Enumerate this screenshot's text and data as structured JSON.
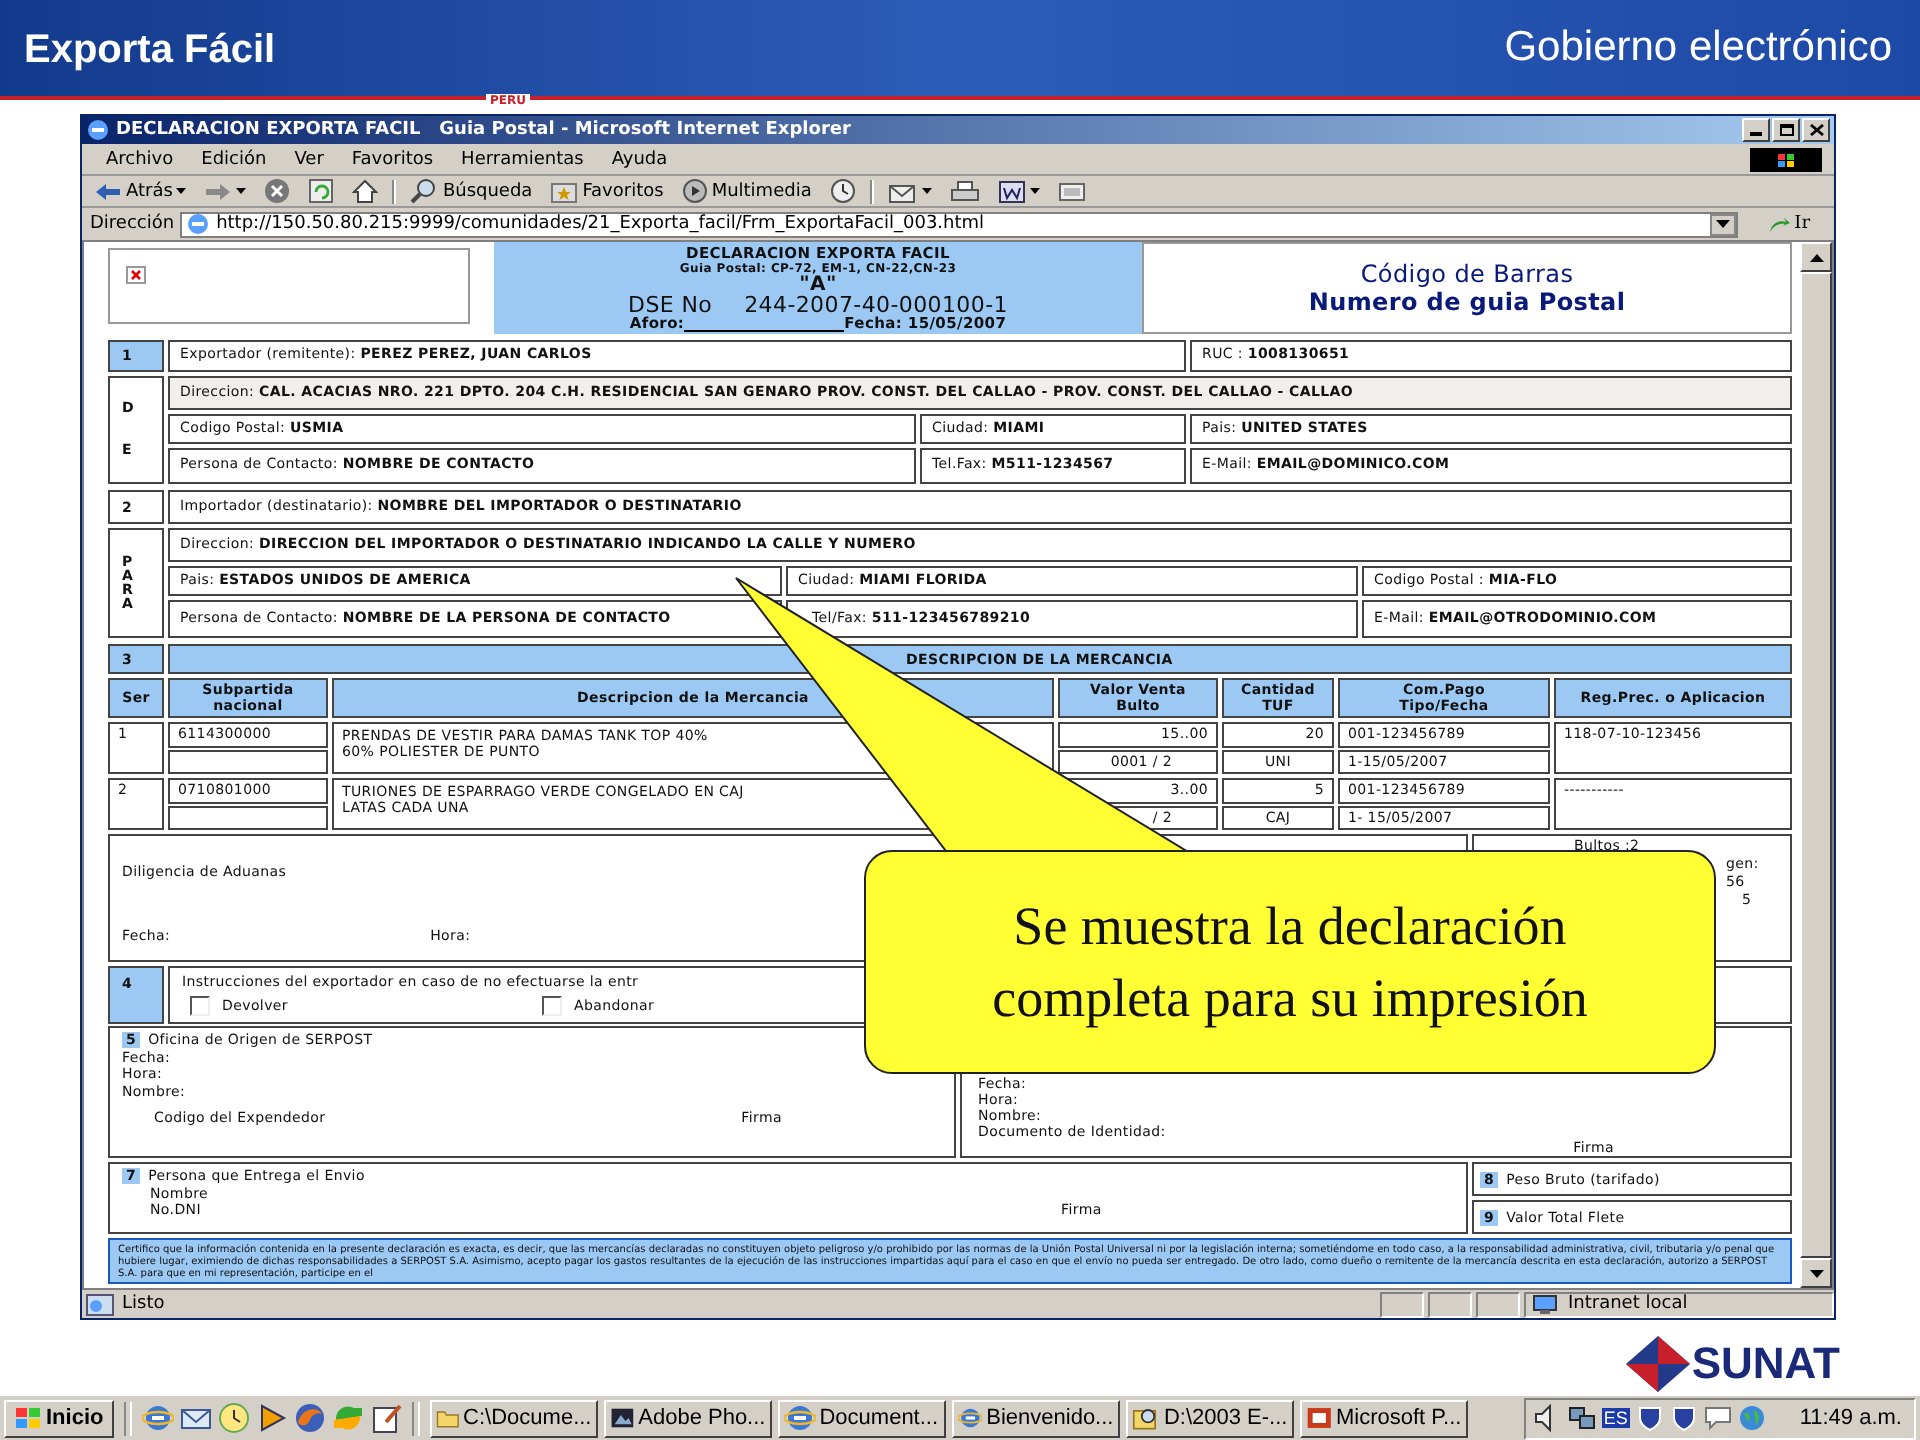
{
  "slide": {
    "title": "Exporta Fácil",
    "subtitle": "Gobierno electrónico",
    "tag": "PERU"
  },
  "window": {
    "title": "DECLARACION EXPORTA FACIL   Guia Postal - Microsoft Internet Explorer"
  },
  "menu": [
    "Archivo",
    "Edición",
    "Ver",
    "Favoritos",
    "Herramientas",
    "Ayuda"
  ],
  "toolbar": [
    {
      "kind": "back",
      "label": "Atrás",
      "dropdown": true
    },
    {
      "kind": "forward",
      "dropdown": true
    },
    {
      "kind": "stop",
      "dropdown": false
    },
    {
      "kind": "refresh",
      "dropdown": false
    },
    {
      "kind": "home",
      "dropdown": false
    },
    {
      "kind": "search",
      "label": "Búsqueda",
      "dropdown": false
    },
    {
      "kind": "favorites",
      "label": "Favoritos",
      "dropdown": false
    },
    {
      "kind": "media",
      "label": "Multimedia",
      "dropdown": false
    },
    {
      "kind": "history",
      "dropdown": false
    },
    {
      "kind": "mail",
      "dropdown": true
    },
    {
      "kind": "print",
      "dropdown": false
    },
    {
      "kind": "word",
      "dropdown": true
    },
    {
      "kind": "discuss",
      "dropdown": false
    }
  ],
  "address": {
    "label": "Dirección",
    "value": "http://150.50.80.215:9999/comunidades/21_Exporta_facil/Frm_ExportaFacil_003.html",
    "go": "Ir"
  },
  "form": {
    "header": {
      "title": "DECLARACION EXPORTA FACIL",
      "guia": "Guia Postal: CP-72, EM-1, CN-22,CN-23",
      "letter": "\"A\"",
      "dse_label": "DSE No",
      "dse": "244-2007-40-000100-1",
      "aforo": "Aforo:",
      "fecha": "Fecha: 15/05/2007",
      "barcode_title": "Código de Barras",
      "barcode_subtitle": "Numero de guia Postal"
    },
    "sections": [
      {
        "number": "1",
        "side": [
          "D",
          "E"
        ],
        "rows": [
          {
            "fields": [
              "Exportador (remitente): **PEREZ PEREZ, JUAN CARLOS**",
              "RUC : **1008130651**"
            ]
          },
          {
            "fields": [
              "Direccion: **CAL. ACACIAS NRO. 221 DPTO. 204 C.H. RESIDENCIAL SAN GENARO  PROV. CONST. DEL CALLAO - PROV. CONST. DEL CALLAO - CALLAO**"
            ]
          },
          {
            "fields": [
              "Codigo Postal: **USMIA**",
              "Ciudad: **MIAMI**",
              "Pais: **UNITED STATES**"
            ]
          },
          {
            "fields": [
              "Persona de Contacto: **NOMBRE DE CONTACTO**",
              "Tel.Fax: **M511-1234567**",
              "E-Mail: **EMAIL@DOMINICO.COM**"
            ]
          }
        ]
      },
      {
        "number": "2",
        "side": [
          "P",
          "A",
          "R",
          "A"
        ],
        "rows": [
          {
            "fields": [
              "Importador (destinatario): **NOMBRE DEL IMPORTADOR O DESTINATARIO**"
            ]
          },
          {
            "fields": [
              "Direccion: **DIRECCION DEL IMPORTADOR O DESTINATARIO INDICANDO LA CALLE Y NUMERO**"
            ]
          },
          {
            "fields": [
              "Pais: **ESTADOS UNIDOS DE AMERICA**",
              "Ciudad: **MIAMI FLORIDA**",
              "Codigo Postal : **MIA-FLO**"
            ]
          },
          {
            "fields": [
              "Persona de Contacto: **NOMBRE DE LA PERSONA DE CONTACTO**",
              "Tel/Fax: **511-123456789210**",
              "E-Mail: **EMAIL@OTRODOMINIO.COM**"
            ]
          }
        ]
      }
    ],
    "goods": {
      "number": "3",
      "title": "DESCRIPCION DE LA MERCANCIA",
      "columns": [
        "Ser",
        "Subpartida nacional",
        "Descripcion de la Mercancia",
        "Valor Venta Bulto",
        "Cantidad TUF",
        "Com.Pago Tipo/Fecha",
        "Reg.Prec. o Aplicacion"
      ],
      "rows": [
        {
          "ser": "1",
          "subpartida": "6114300000",
          "description": [
            "PRENDAS DE VESTIR PARA DAMAS TANK TOP 40%",
            "60% POLIESTER DE PUNTO"
          ],
          "value": "15..00",
          "packages": "0001 / 2",
          "quantity": "20",
          "unit": "UNI",
          "payment": "001-123456789",
          "payment_date": "1-15/05/2007",
          "regime": "118-07-10-123456"
        },
        {
          "ser": "2",
          "subpartida": "0710801000",
          "description": [
            "TURIONES DE ESPARRAGO VERDE CONGELADO EN CAJ",
            "LATAS CADA UNA"
          ],
          "value": "3..00",
          "packages": "/ 2",
          "quantity": "5",
          "unit": "CAJ",
          "payment": "001-123456789",
          "payment_date": "1- 15/05/2007",
          "regime": "-----------"
        }
      ]
    },
    "customs": {
      "title": "Diligencia de Aduanas",
      "date": "Fecha:",
      "time": "Hora:",
      "summary": [
        "Bultos :2",
        "gen:",
        "56",
        "5"
      ]
    },
    "instructions": {
      "number": "4",
      "text": "Instrucciones del exportador en caso de no efectuarse la entr",
      "options": [
        {
          "label": "Devolver",
          "checked": false
        },
        {
          "label": "Abandonar",
          "checked": false
        }
      ]
    },
    "origin": {
      "number": "5",
      "title": "Oficina de Origen de SERPOST",
      "fields": [
        "Fecha:",
        "Hora:",
        "Nombre:"
      ],
      "code": "Codigo del Expendedor",
      "signature": "Firma",
      "recipient_fields": [
        "Fecha:",
        "Hora:",
        "Nombre:",
        "Documento de Identidad:"
      ],
      "recipient_signature": "Firma"
    },
    "sender": {
      "number": "7",
      "title": "Persona que Entrega el Envio",
      "fields": [
        "Nombre",
        "No.DNI"
      ],
      "signature": "Firma",
      "totals": [
        {
          "number": "8",
          "label": "Peso Bruto (tarifado)"
        },
        {
          "number": "9",
          "label": "Valor Total Flete"
        }
      ]
    },
    "certification": "Certifico que la información contenida en la presente declaración es exacta, es decir, que las mercancías declaradas no constituyen objeto peligroso y/o prohibido por las normas de la Unión Postal Universal ni por la legislación interna; sometiéndome en todo caso, a la responsabilidad administrativa, civil, tributaria y/o penal que hubiere lugar, eximiendo de dichas responsabilidades a SERPOST S.A. Asimismo, acepto pagar los gastos resultantes de la ejecución de las instrucciones impartidas aquí para el caso en que el envío no pueda ser entregado. De otro lado, como dueño o remitente de la mercancía descrita en esta declaración, autorizo a SERPOST S.A. para que en mi representación, participe en el"
  },
  "callout": {
    "lines": [
      "Se muestra la declaración",
      "completa para su impresión"
    ]
  },
  "status": {
    "text": "Listo",
    "zone": "Intranet local"
  },
  "logo": "SUNAT",
  "taskbar": {
    "start": "Inicio",
    "quick_launch": [
      {
        "kind": "browser"
      },
      {
        "kind": "mail"
      },
      {
        "kind": "clock"
      },
      {
        "kind": "media"
      },
      {
        "kind": "fox"
      },
      {
        "kind": "arrows"
      },
      {
        "kind": "notepad"
      }
    ],
    "tasks": [
      {
        "kind": "folder",
        "label": "C:\\Docume..."
      },
      {
        "kind": "photo",
        "label": "Adobe Pho..."
      },
      {
        "kind": "browser",
        "label": "Document..."
      },
      {
        "kind": "browser",
        "label": "Bienvenido..."
      },
      {
        "kind": "search",
        "label": "D:\\2003 E-..."
      },
      {
        "kind": "slides",
        "label": "Microsoft P..."
      }
    ],
    "tray": [
      {
        "kind": "speaker"
      },
      {
        "kind": "network"
      },
      {
        "kind": "lang",
        "label": "ES"
      },
      {
        "kind": "shield"
      },
      {
        "kind": "shield"
      },
      {
        "kind": "chat"
      },
      {
        "kind": "globe"
      }
    ],
    "clock": "11:49 a.m."
  }
}
